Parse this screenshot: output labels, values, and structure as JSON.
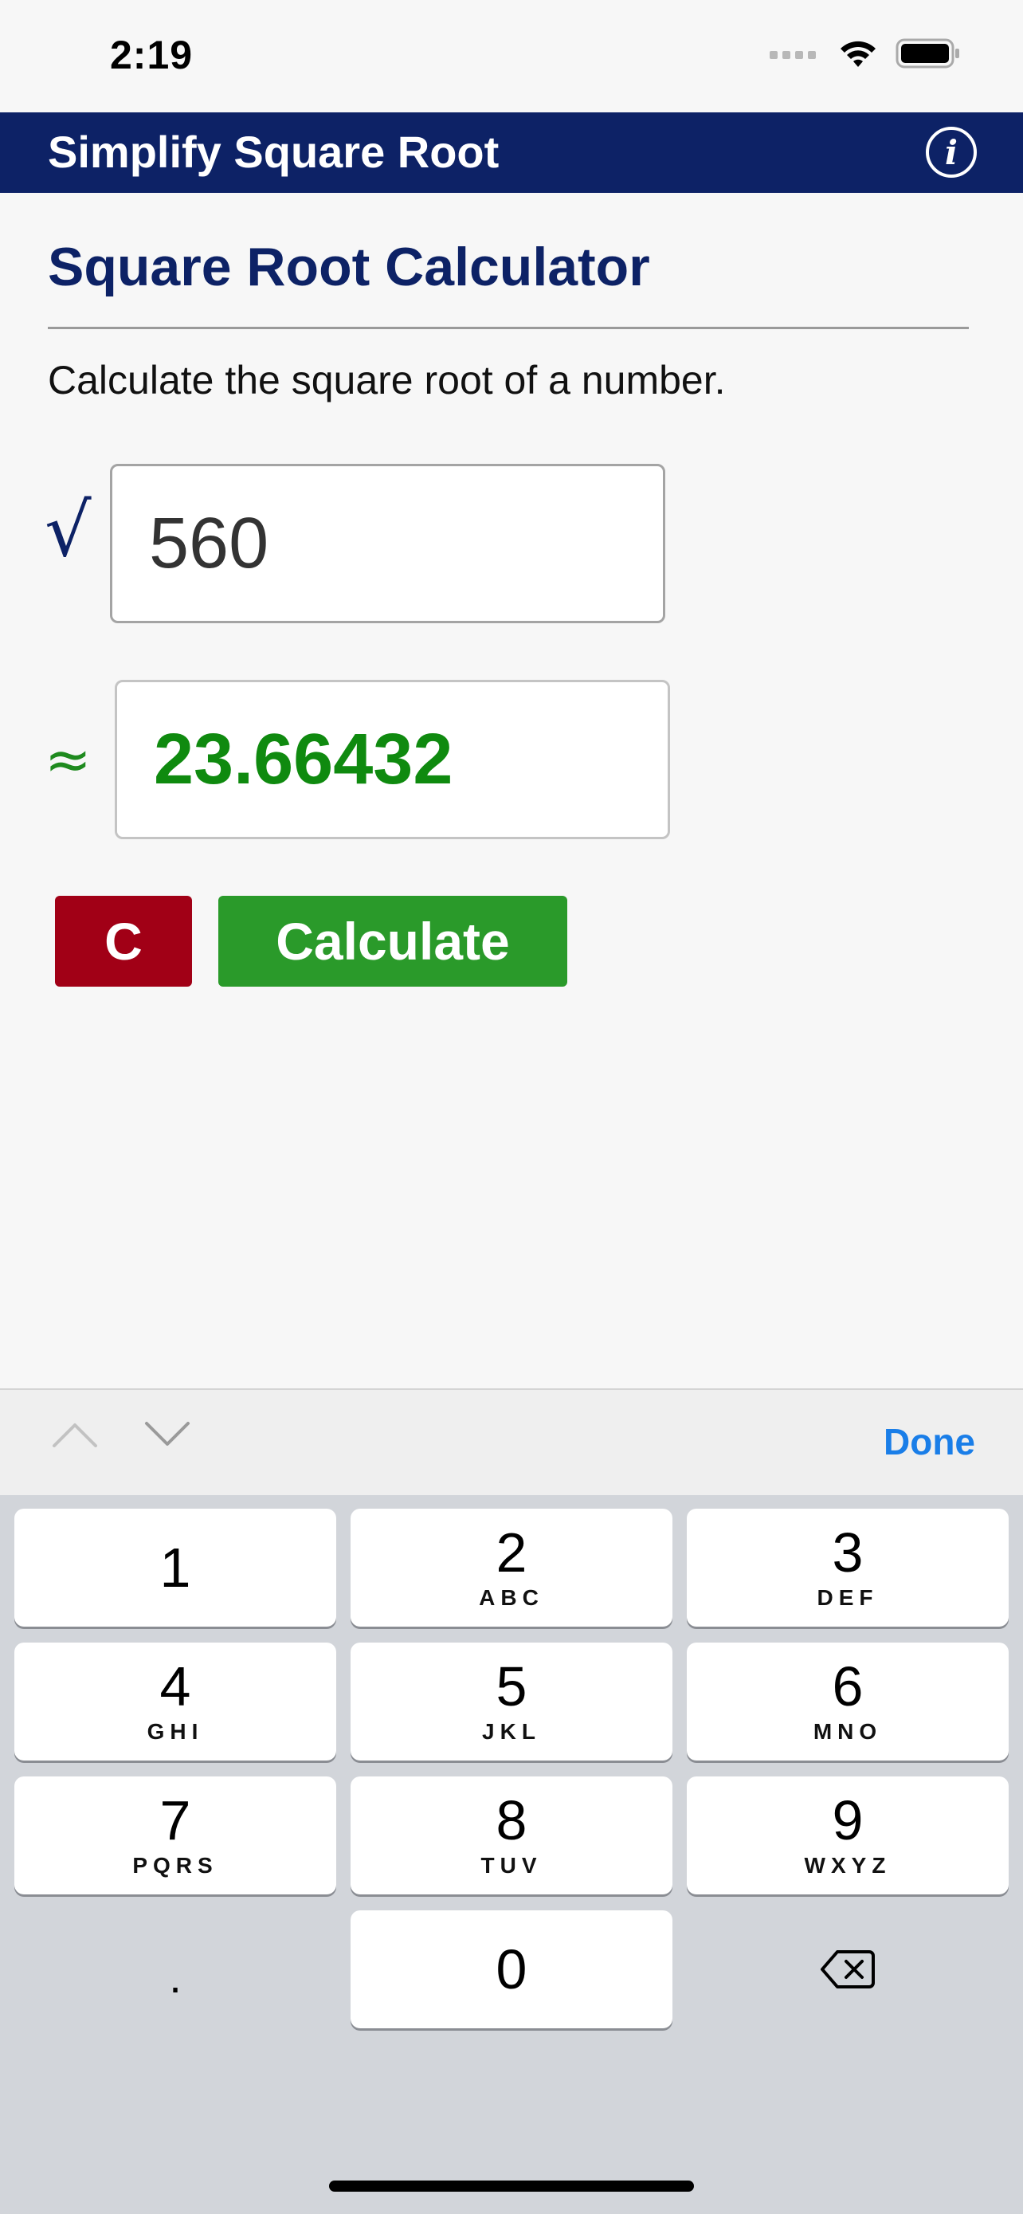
{
  "status_bar": {
    "time": "2:19",
    "icons": [
      "signal-icon",
      "wifi-icon",
      "battery-icon"
    ]
  },
  "header": {
    "title": "Simplify Square Root",
    "info_icon_label": "i"
  },
  "main": {
    "heading": "Square Root Calculator",
    "description": "Calculate the square root of a number.",
    "sqrt_symbol": "√",
    "input_value": "560",
    "approx_symbol": "≈",
    "result_value": "23.66432",
    "clear_label": "C",
    "calculate_label": "Calculate"
  },
  "keyboard": {
    "done_label": "Done",
    "keys": [
      {
        "num": "1",
        "letters": ""
      },
      {
        "num": "2",
        "letters": "ABC"
      },
      {
        "num": "3",
        "letters": "DEF"
      },
      {
        "num": "4",
        "letters": "GHI"
      },
      {
        "num": "5",
        "letters": "JKL"
      },
      {
        "num": "6",
        "letters": "MNO"
      },
      {
        "num": "7",
        "letters": "PQRS"
      },
      {
        "num": "8",
        "letters": "TUV"
      },
      {
        "num": "9",
        "letters": "WXYZ"
      },
      {
        "num": "0",
        "letters": ""
      }
    ],
    "decimal_key": "."
  },
  "colors": {
    "header_bg": "#0d2266",
    "heading": "#0d2266",
    "result_text": "#0f8a0f",
    "clear_button": "#a10016",
    "calculate_button": "#2a9a2a",
    "done_text": "#1a7ee8"
  }
}
